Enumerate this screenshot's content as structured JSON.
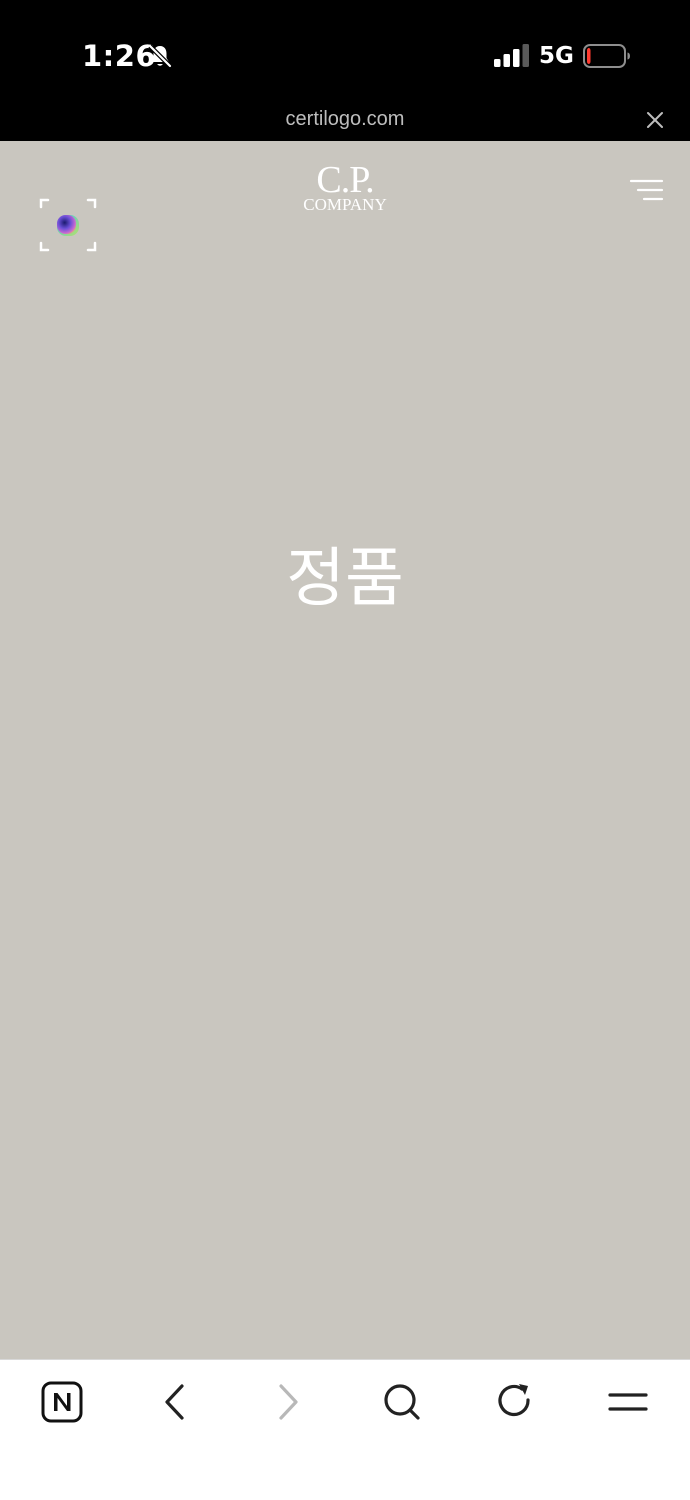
{
  "status_bar": {
    "time": "1:26",
    "network": "5G",
    "icons": [
      "bell-off-icon",
      "signal-icon",
      "battery-icon"
    ],
    "battery_level": 0.1,
    "battery_color": "#ff3b30"
  },
  "url_bar": {
    "url": "certilogo.com",
    "close_icon": "close-icon"
  },
  "header": {
    "logo_line1": "C.P.",
    "logo_line2": "COMPANY",
    "menu_icon": "hamburger-menu-icon",
    "scan_icon": "scan-frame-icon"
  },
  "main": {
    "verdict": "정품"
  },
  "toolbar": {
    "buttons": [
      "naver-home-icon",
      "back-icon",
      "forward-icon",
      "search-icon",
      "reload-icon",
      "menu-icon"
    ],
    "forward_enabled": false
  },
  "colors": {
    "page_background": "#c9c6bf",
    "bars": "#000000",
    "toolbar": "#ffffff"
  }
}
